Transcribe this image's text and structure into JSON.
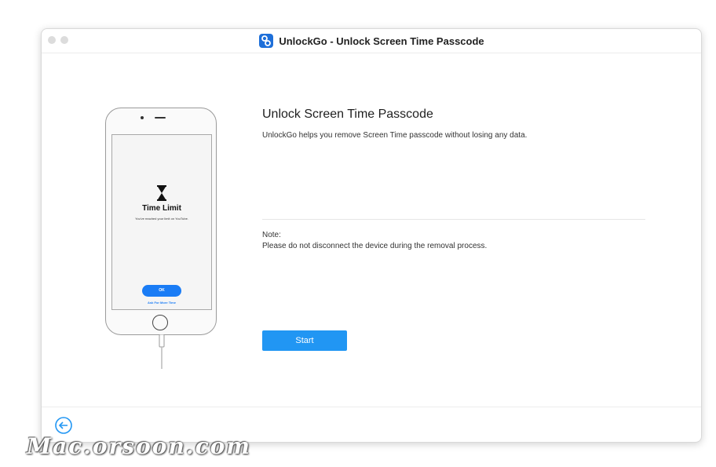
{
  "window": {
    "title": "UnlockGo - Unlock Screen Time Passcode"
  },
  "phone_screen": {
    "title": "Time Limit",
    "subtitle": "You've reached your limit on YouTube.",
    "ok_label": "OK",
    "ask_more_label": "Ask For More Time"
  },
  "main": {
    "heading": "Unlock Screen Time Passcode",
    "description": "UnlockGo helps you remove Screen Time passcode without losing any data.",
    "note_label": "Note:",
    "note_text": "Please do not disconnect the device during the removal process.",
    "start_label": "Start"
  },
  "watermark": "Mac.orsoon.com",
  "colors": {
    "accent": "#2196f3",
    "phone_button": "#1a7cf5",
    "logo": "#1e6fd9"
  }
}
